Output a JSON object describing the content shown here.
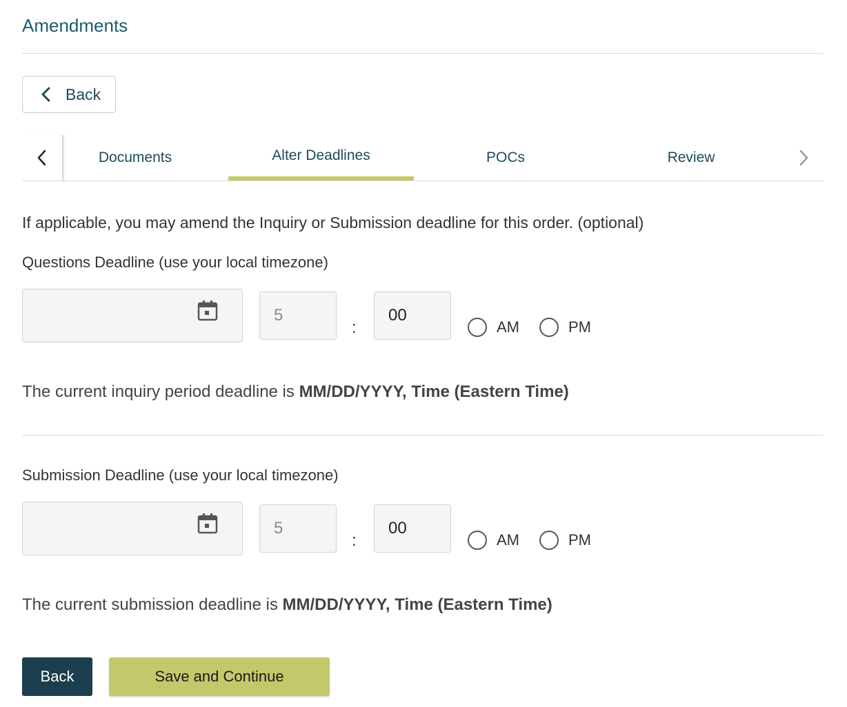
{
  "page": {
    "title": "Amendments"
  },
  "nav": {
    "back_label": "Back"
  },
  "tabs": [
    {
      "label": "Documents",
      "active": false
    },
    {
      "label": "Alter Deadlines",
      "active": true
    },
    {
      "label": "POCs",
      "active": false
    },
    {
      "label": "Review",
      "active": false
    }
  ],
  "intro": "If applicable, you may amend the Inquiry or Submission deadline for this order. (optional)",
  "questions": {
    "label": "Questions Deadline (use your local timezone)",
    "date_value": "",
    "hour_placeholder": "5",
    "minute_value": "00",
    "colon": ":",
    "am_label": "AM",
    "pm_label": "PM",
    "current_prefix": "The current inquiry period deadline is ",
    "current_value": "MM/DD/YYYY, Time (Eastern Time)"
  },
  "submission": {
    "label": "Submission Deadline (use your local timezone)",
    "date_value": "",
    "hour_placeholder": "5",
    "minute_value": "00",
    "colon": ":",
    "am_label": "AM",
    "pm_label": "PM",
    "current_prefix": "The current submission deadline is ",
    "current_value": "MM/DD/YYYY, Time (Eastern Time)"
  },
  "footer": {
    "back_label": "Back",
    "save_label": "Save and Continue"
  },
  "colors": {
    "accent": "#c3c96b",
    "primary_dark": "#1b3f4e",
    "title": "#1d5a6e"
  },
  "icons": {
    "calendar": "calendar-icon",
    "chevron_left": "chevron-left-icon",
    "chevron_right": "chevron-right-icon"
  }
}
